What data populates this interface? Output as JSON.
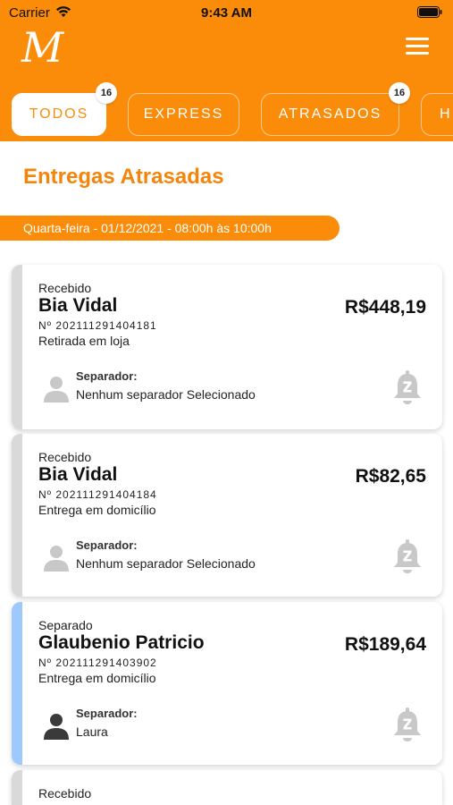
{
  "status_bar": {
    "carrier": "Carrier",
    "time": "9:43 AM"
  },
  "header": {
    "logo": "M",
    "menu_icon": "hamburger-menu-icon"
  },
  "tabs": [
    {
      "label": "TODOS",
      "active": true,
      "badge": "16"
    },
    {
      "label": "EXPRESS",
      "active": false,
      "badge": ""
    },
    {
      "label": "ATRASADOS",
      "active": false,
      "badge": "16"
    },
    {
      "label": "H",
      "active": false,
      "badge": ""
    }
  ],
  "section_title": "Entregas Atrasadas",
  "date_window": "Quarta-feira - 01/12/2021 - 08:00h às 10:00h",
  "separator_label": "Separador:",
  "colors": {
    "brand_orange": "#fb8c0a",
    "stripe_gray": "#d9d9d9",
    "stripe_blue": "#9dc9ff",
    "icon_gray": "#c8c8c8",
    "icon_dark": "#3a3a3a"
  },
  "orders": [
    {
      "status": "Recebido",
      "customer": "Bia Vidal",
      "price": "R$448,19",
      "order_number": "Nº 202111291404181",
      "delivery_type": "Retirada em loja",
      "separator": "Nenhum separador Selecionado"
    },
    {
      "status": "Recebido",
      "customer": "Bia Vidal",
      "price": "R$82,65",
      "order_number": "Nº 202111291404184",
      "delivery_type": "Entrega em domicílio",
      "separator": "Nenhum separador Selecionado"
    },
    {
      "status": "Separado",
      "customer": "Glaubenio Patricio",
      "price": "R$189,64",
      "order_number": "Nº 202111291403902",
      "delivery_type": "Entrega em domicílio",
      "separator": "Laura"
    },
    {
      "status": "Recebido",
      "customer": "",
      "price": "",
      "order_number": "",
      "delivery_type": "",
      "separator": ""
    }
  ]
}
